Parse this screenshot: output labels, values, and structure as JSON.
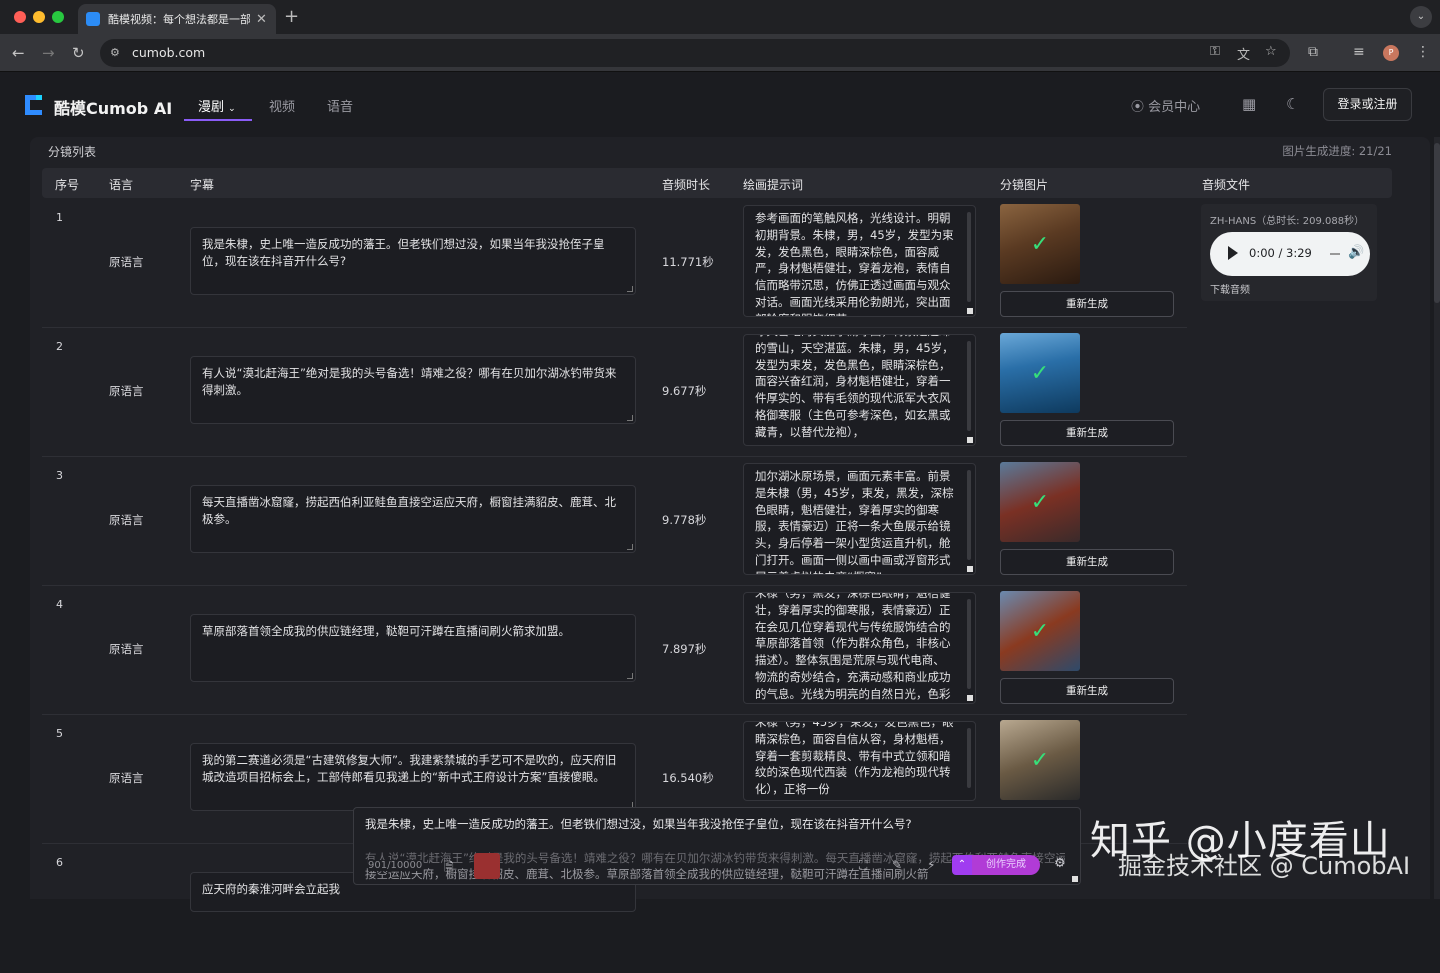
{
  "browser": {
    "tab_title": "酷模视频：每个想法都是一部大",
    "url": "cumob.com",
    "colors": {
      "close": "#ff5f57",
      "min": "#febc2e",
      "max": "#28c840"
    },
    "profile_initial": "P"
  },
  "header": {
    "brand": "酷模Cumob AI",
    "nav": [
      {
        "label": "漫剧",
        "active": true,
        "dropdown": true
      },
      {
        "label": "视频",
        "active": false
      },
      {
        "label": "语音",
        "active": false
      }
    ],
    "member_center": "会员中心",
    "login_button": "登录或注册",
    "accent": "#8a5cf6"
  },
  "panel": {
    "title": "分镜列表",
    "progress": "图片生成进度: 21/21",
    "columns": [
      "序号",
      "语言",
      "字幕",
      "音频时长",
      "绘画提示词",
      "分镜图片",
      "音频文件"
    ],
    "rows": [
      {
        "index": "1",
        "language": "原语言",
        "subtitle": "我是朱棣，史上唯一造反成功的藩王。但老铁们想过没，如果当年我没抢侄子皇位，现在该在抖音开什么号?",
        "duration": "11.771秒",
        "prompt": "参考画面的笔触风格，光线设计。明朝初期背景。朱棣，男，45岁，发型为束发，发色黑色，眼睛深棕色，面容威严，身材魁梧健壮，穿着龙袍，表情自信而略带沉思，仿佛正透过画面与观众对话。画面光线采用伦勃朗光，突出面部轮廓和服饰细节。",
        "regen": "重新生成",
        "image_colors": [
          "#5a3a22",
          "#2a1a10"
        ]
      },
      {
        "index": "2",
        "language": "原语言",
        "subtitle": "有人说“漠北赶海王”绝对是我的头号备选！靖难之役？哪有在贝加尔湖冰钓带货来得刺激。",
        "duration": "9.677秒",
        "prompt": "冰天雪地的贝加尔湖冰面，背景是连绵的雪山，天空湛蓝。朱棣，男，45岁，发型为束发，发色黑色，眼睛深棕色，面容兴奋红润，身材魁梧健壮，穿着一件厚实的、带有毛领的现代派军大衣风格御寒服（主色可参考深色，如玄黑或藏青，以替代龙袍），",
        "regen": "重新生成",
        "image_colors": [
          "#2a6fa8",
          "#0e3a5e"
        ]
      },
      {
        "index": "3",
        "language": "原语言",
        "subtitle": "每天直播凿冰窟窿，捞起西伯利亚鲑鱼直接空运应天府，橱窗挂满貂皮、鹿茸、北极参。",
        "duration": "9.778秒",
        "prompt": "加尔湖冰原场景，画面元素丰富。前景是朱棣（男，45岁，束发，黑发，深棕色眼睛，魁梧健壮，穿着厚实的御寒服，表情豪迈）正将一条大鱼展示给镜头，身后停着一架小型货运直升机，舱门打开。画面一侧以画中画或浮窗形式展示着虚拟的电商“橱窗”",
        "regen": "重新生成",
        "image_colors": [
          "#7a3024",
          "#3a5a7a"
        ]
      },
      {
        "index": "4",
        "language": "原语言",
        "subtitle": "草原部落首领全成我的供应链经理，鞑靼可汗蹲在直播间刷火箭求加盟。",
        "duration": "7.897秒",
        "prompt": "朱棣（男，黑发，深棕色眼睛，魁梧健壮，穿着厚实的御寒服，表情豪迈）正在会见几位穿着现代与传统服饰结合的草原部落首领（作为群众角色，非核心描述）。整体氛围是荒原与现代电商、物流的奇妙结合，充满动感和商业成功的气息。光线为明亮的自然日光，色彩饱和度高，中景镜头，镜头",
        "regen": "重新生成",
        "image_colors": [
          "#8a3a20",
          "#2e4a6a"
        ]
      },
      {
        "index": "5",
        "language": "原语言",
        "subtitle": "我的第二赛道必须是“古建筑修复大师”。我建紫禁城的手艺可不是吹的，应天府旧城改造项目招标会上，工部侍郎看见我递上的“新中式王府设计方案”直接傻眼。",
        "duration": "16.540秒",
        "prompt": "朱棣（男，45岁，束发，发色黑色，眼睛深棕色，面容自信从容，身材魁梧，穿着一套剪裁精良、带有中式立领和暗纹的深色现代西装（作为龙袍的现代转化），正将一份",
        "regen": "重新生成",
        "image_colors": [
          "#6a5a44",
          "#2a2a2a"
        ]
      },
      {
        "index": "6",
        "language": "原语言",
        "subtitle": "应天府的秦淮河畔会立起我",
        "duration": "",
        "prompt": "",
        "regen": "",
        "image_colors": [
          "#333",
          "#222"
        ]
      }
    ],
    "audio": {
      "title": "ZH-HANS（总时长: 209.088秒）",
      "time": "0:00 / 3:29",
      "download": "下载音频"
    }
  },
  "editor": {
    "line1": "我是朱棣，史上唯一造反成功的藩王。但老铁们想过没，如果当年我没抢侄子皇位，现在该在抖音开什么号?",
    "line2": "有人说“漠北赶海王”绝对是我的头号备选！靖难之役？哪有在贝加尔湖冰钓带货来得刺激。每天直播凿冰窟窿，捞起西伯利亚鲑鱼直接空运应天府，橱窗",
    "line3": "接空运应天府，橱窗挂满貂皮、鹿茸、北极参。草原部落首领全成我的供应链经理，鞑靼可汗蹲在直播间刷火箭",
    "counter": "901/10000",
    "done_button": "创作完成"
  },
  "watermark": {
    "line1": "知乎 @小度看山",
    "line2": "掘金技术社区 @ CumobAI"
  }
}
